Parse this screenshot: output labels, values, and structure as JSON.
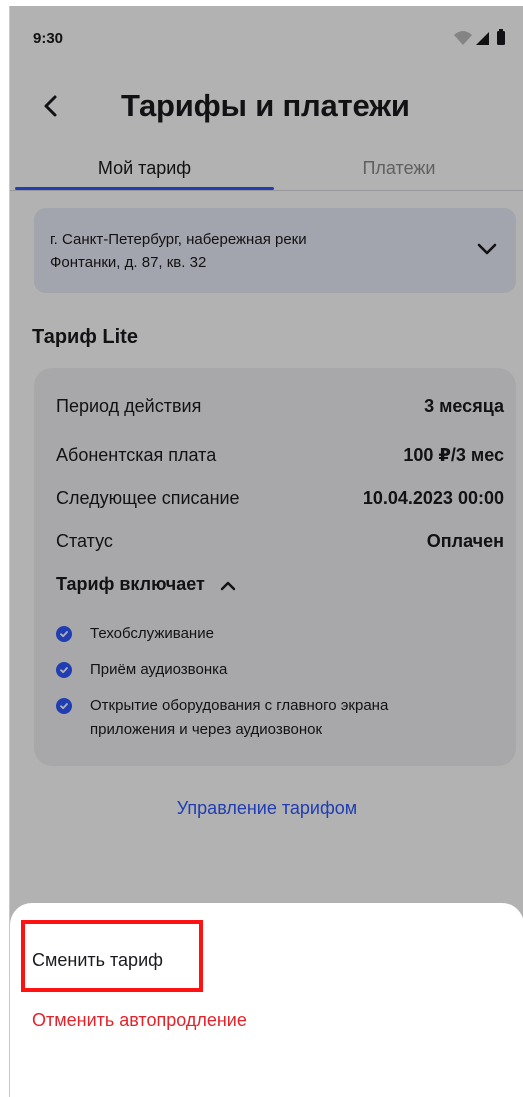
{
  "status_bar": {
    "time": "9:30",
    "icons": [
      "wifi-icon",
      "signal-icon",
      "battery-icon"
    ]
  },
  "header": {
    "back_icon": "chevron-left-icon",
    "title": "Тарифы и платежи"
  },
  "tabs": [
    {
      "label": "Мой тариф",
      "active": true
    },
    {
      "label": "Платежи",
      "active": false
    }
  ],
  "address": {
    "line1": "г. Санкт-Петербург, набережная реки",
    "line2": "Фонтанки, д. 87, кв. 32",
    "icon": "chevron-down-icon"
  },
  "tariff": {
    "title": "Тариф Lite",
    "rows": [
      {
        "label": "Период действия",
        "value": "3 месяца"
      },
      {
        "label": "Абонентская плата",
        "value": "100 ₽/3 мес"
      },
      {
        "label": "Следующее списание",
        "value": "10.04.2023 00:00"
      },
      {
        "label": "Статус",
        "value": "Оплачен"
      }
    ],
    "includes_label": "Тариф включает",
    "features": [
      {
        "text": "Техобслуживание"
      },
      {
        "text": "Приём аудиозвонка"
      },
      {
        "text_line1": "Открытие оборудования с главного экрана",
        "text_line2": "приложения и через аудиозвонок"
      }
    ]
  },
  "manage_link": "Управление тарифом",
  "sheet": {
    "change_tariff": "Сменить тариф",
    "cancel_autorenew": "Отменить автопродление"
  },
  "colors": {
    "accent": "#2e58ff",
    "danger": "#e5212a",
    "highlight": "#ff1212",
    "address_bg": "#e9ecf8",
    "card_bg": "#f1f1f4"
  }
}
